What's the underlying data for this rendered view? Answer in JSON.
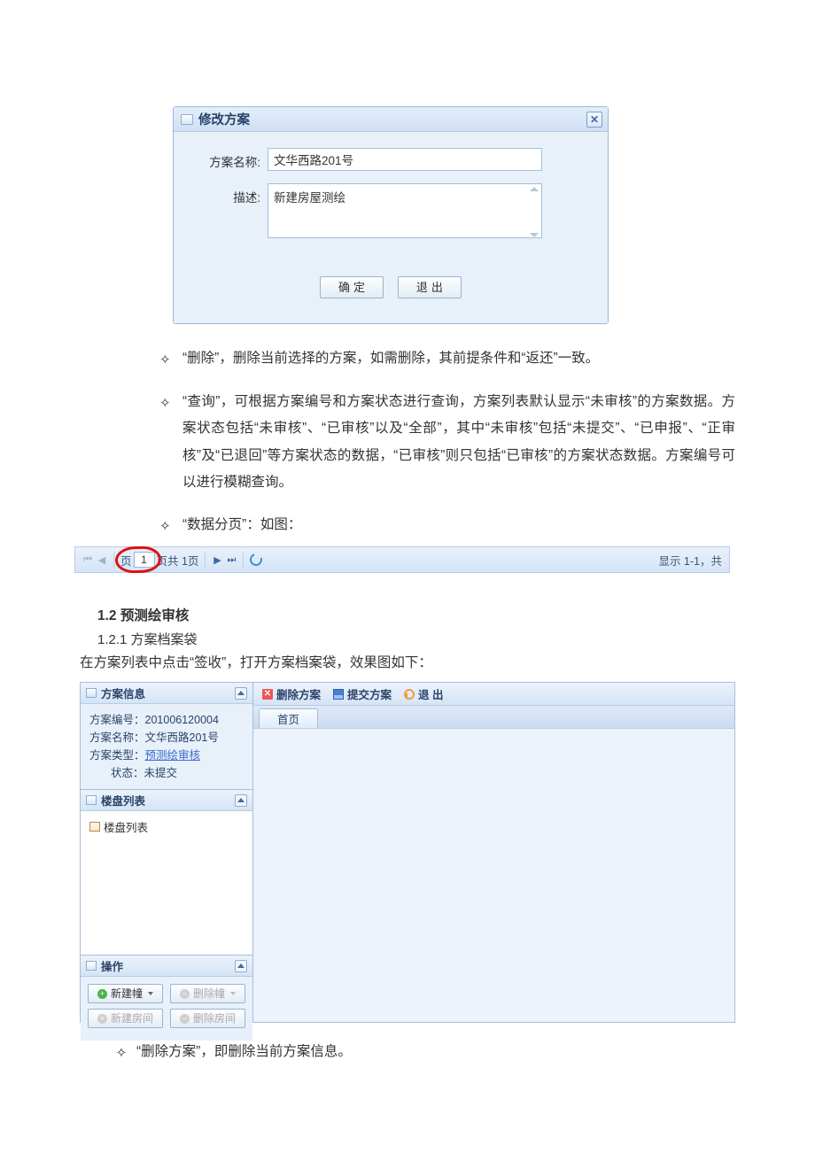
{
  "dialog": {
    "title": "修改方案",
    "close_glyph": "✕",
    "labels": {
      "name": "方案名称:",
      "desc": "描述:"
    },
    "values": {
      "name": "文华西路201号",
      "desc": "新建房屋测绘"
    },
    "buttons": {
      "ok": "确定",
      "exit": "退出"
    }
  },
  "doc_bullets": {
    "b_delete": "“删除”，删除当前选择的方案，如需删除，其前提条件和“返还”一致。",
    "b_query": "“查询”，可根据方案编号和方案状态进行查询，方案列表默认显示“未审核”的方案数据。方案状态包括“未审核”、“已审核”以及“全部”，其中“未审核”包括“未提交”、“已申报”、“正审核”及“已退回”等方案状态的数据，“已审核”则只包括“已审核”的方案状态数据。方案编号可以进行模糊查询。",
    "b_page": "“数据分页”：如图："
  },
  "pager": {
    "page_input": "1",
    "pre_text": "页",
    "total_text": "页共 1页",
    "right_text": "显示 1-1，共"
  },
  "section": {
    "h12": "1.2 预测绘审核",
    "h121": "1.2.1 方案档案袋",
    "lead": "在方案列表中点击“签收”，打开方案档案袋，效果图如下："
  },
  "app": {
    "left": {
      "info_title": "方案信息",
      "info": {
        "no_label": "方案编号：",
        "no": "201006120004",
        "name_label": "方案名称：",
        "name": "文华西路201号",
        "type_label": "方案类型：",
        "type": "预测绘审核",
        "status_label": "状态：",
        "status": "未提交"
      },
      "list_title": "楼盘列表",
      "list_item": "楼盘列表",
      "ops_title": "操作",
      "ops": {
        "new_bldg": "新建幢",
        "del_bldg": "删除幢",
        "new_room": "新建房间",
        "del_room": "删除房间"
      }
    },
    "toolbar": {
      "delete": "删除方案",
      "submit": "提交方案",
      "exit": "退 出"
    },
    "tab_home": "首页"
  },
  "trailing_bullet": "“删除方案”，即删除当前方案信息。"
}
